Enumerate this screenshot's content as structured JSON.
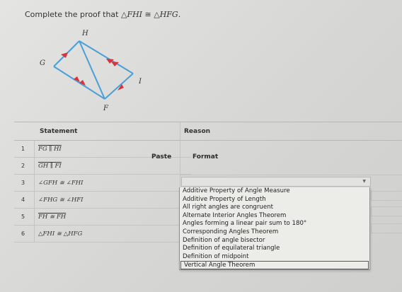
{
  "prompt": {
    "text": "Complete the proof that ",
    "triangle1": "△FHI",
    "cong": " ≅ ",
    "triangle2": "△HFG",
    "end": "."
  },
  "figure": {
    "vertices": [
      "H",
      "G",
      "I",
      "F"
    ],
    "line_color": "#4a9fd8",
    "arrow_color": "#d9343c"
  },
  "table": {
    "statement_header": "Statement",
    "reason_header": "Reason",
    "rows": [
      {
        "num": "1",
        "statement": "FG ∥ HI"
      },
      {
        "num": "2",
        "statement": "GH ∥ FI"
      },
      {
        "num": "3",
        "statement": "∠GFH ≅ ∠FHI"
      },
      {
        "num": "4",
        "statement": "∠FHG ≅ ∠HFI"
      },
      {
        "num": "5",
        "statement": "FH ≅ FH"
      },
      {
        "num": "6",
        "statement": "△FHI ≅ △HFG"
      }
    ]
  },
  "toolbar": {
    "paste": "Paste",
    "format": "Format"
  },
  "dropdown": {
    "options": [
      "Additive Property of Angle Measure",
      "Additive Property of Length",
      "All right angles are congruent",
      "Alternate Interior Angles Theorem",
      "Angles forming a linear pair sum to 180°",
      "Corresponding Angles Theorem",
      "Definition of angle bisector",
      "Definition of equilateral triangle",
      "Definition of midpoint",
      "Vertical Angle Theorem"
    ]
  }
}
